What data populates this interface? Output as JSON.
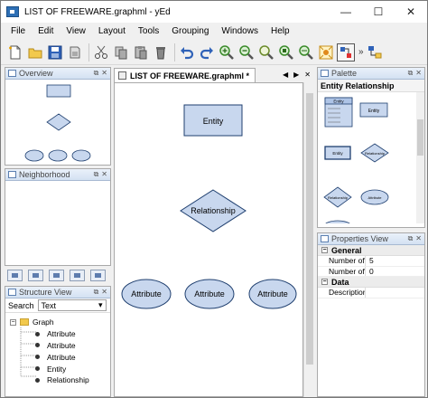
{
  "window": {
    "title": "LIST OF FREEWARE.graphml - yEd",
    "min": "—",
    "max": "☐",
    "close": "✕"
  },
  "menu": [
    "File",
    "Edit",
    "View",
    "Layout",
    "Tools",
    "Grouping",
    "Windows",
    "Help"
  ],
  "toolbar": {
    "icons": [
      "new-file-icon",
      "open-folder-icon",
      "save-icon",
      "print-icon",
      "cut-icon",
      "copy-icon",
      "paste-icon",
      "delete-icon",
      "undo-icon",
      "redo-icon",
      "zoom-in-icon",
      "zoom-out-icon",
      "zoom-fit-icon",
      "zoom-selection-icon",
      "zoom-area-icon",
      "fit-content-icon",
      "grid-icon",
      "layout-icon"
    ],
    "more": "»"
  },
  "panels": {
    "overview": "Overview",
    "neighborhood": "Neighborhood",
    "structure": "Structure View",
    "palette": "Palette",
    "properties": "Properties View"
  },
  "structure": {
    "search_label": "Search",
    "search_value": "Text",
    "root": "Graph",
    "children": [
      "Attribute",
      "Attribute",
      "Attribute",
      "Entity",
      "Relationship"
    ]
  },
  "tab": {
    "title": "LIST OF FREEWARE.graphml *"
  },
  "canvas": {
    "entity": "Entity",
    "relationship": "Relationship",
    "attributes": [
      "Attribute",
      "Attribute",
      "Attribute"
    ]
  },
  "palette": {
    "section": "Entity Relationship",
    "items": [
      "Entity",
      "Entity",
      "Relationship",
      "Attribute",
      "Attribute"
    ]
  },
  "properties": {
    "general": "General",
    "rows": [
      {
        "key": "Number of...",
        "value": "5"
      },
      {
        "key": "Number of...",
        "value": "0"
      }
    ],
    "data": "Data",
    "data_rows": [
      {
        "key": "Description",
        "value": ""
      }
    ]
  },
  "colors": {
    "node_fill": "#c8d7ee",
    "node_stroke": "#1f3f6f",
    "panel_header": "#d3e1f2"
  }
}
